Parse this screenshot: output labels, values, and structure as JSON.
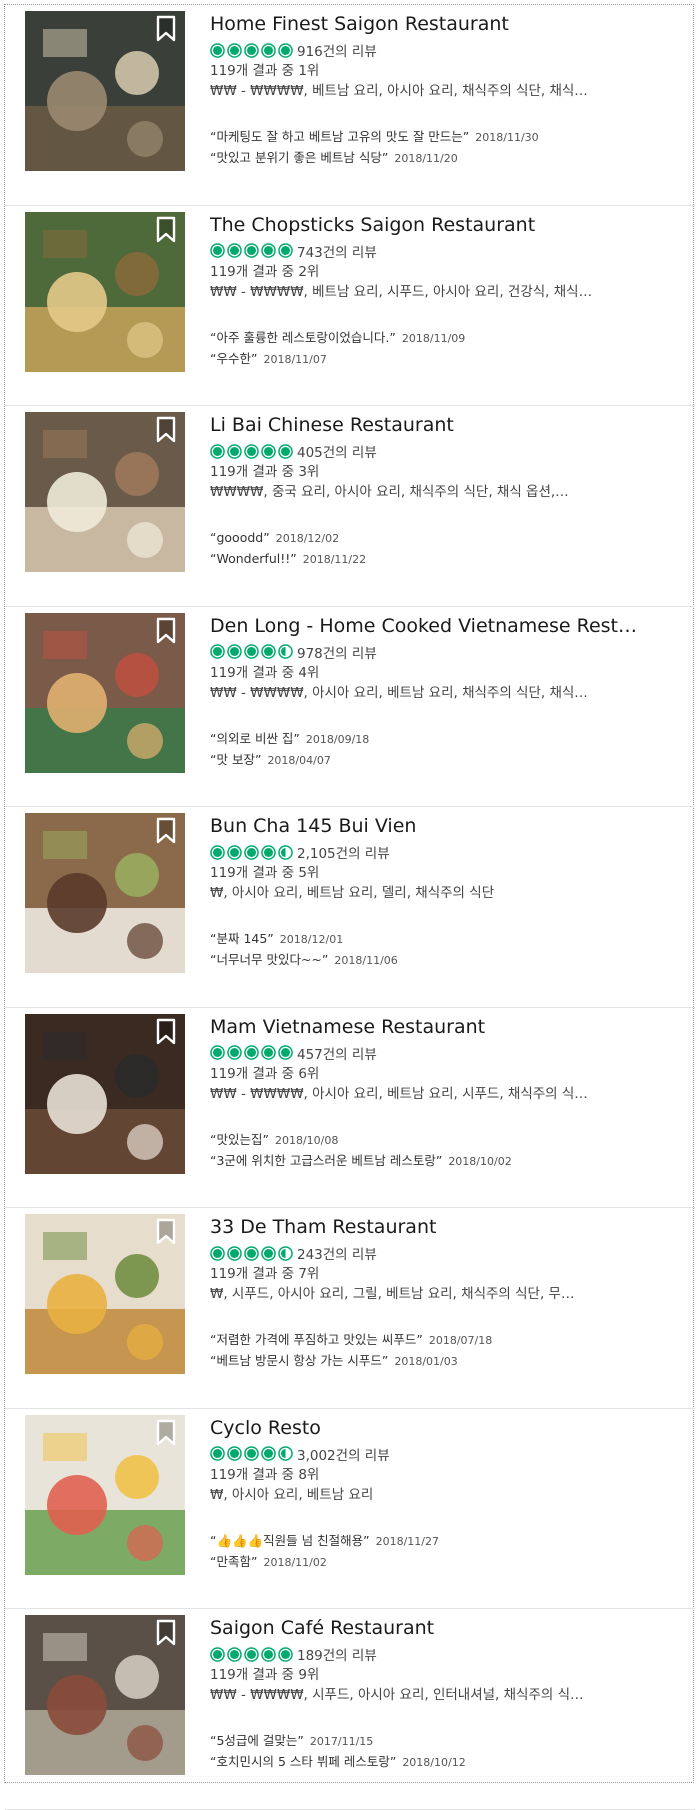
{
  "colors": {
    "bubble": "#00aa6c",
    "divider": "#e3e3e3",
    "bookmark": "#ffffff"
  },
  "restaurants": [
    {
      "name": "Home Finest Saigon Restaurant",
      "rating": 5,
      "reviews": "916건의 리뷰",
      "rank": "119개 결과 중 1위",
      "cuisine": "₩₩ - ₩₩₩₩, 베트남 요리, 아시아 요리, 채식주의 식단, 채식…",
      "snippets": [
        {
          "text": "“마케팅도 잘 하고 베트남 고유의 맛도 잘 만드는”",
          "date": "2018/11/30"
        },
        {
          "text": "“맛있고 분위기 좋은 베트남 식당”",
          "date": "2018/11/20"
        }
      ]
    },
    {
      "name": "The Chopsticks Saigon Restaurant",
      "rating": 5,
      "reviews": "743건의 리뷰",
      "rank": "119개 결과 중 2위",
      "cuisine": "₩₩ - ₩₩₩₩, 베트남 요리, 시푸드, 아시아 요리, 건강식, 채식…",
      "snippets": [
        {
          "text": "“아주 훌륭한 레스토랑이었습니다.”",
          "date": "2018/11/09"
        },
        {
          "text": "“우수한”",
          "date": "2018/11/07"
        }
      ]
    },
    {
      "name": "Li Bai Chinese Restaurant",
      "rating": 5,
      "reviews": "405건의 리뷰",
      "rank": "119개 결과 중 3위",
      "cuisine": "₩₩₩₩, 중국 요리, 아시아 요리, 채식주의 식단, 채식 옵션,…",
      "snippets": [
        {
          "text": "“gooodd”",
          "date": "2018/12/02"
        },
        {
          "text": "“Wonderful!!”",
          "date": "2018/11/22"
        }
      ]
    },
    {
      "name": "Den Long - Home Cooked Vietnamese Resta…",
      "rating": 4.5,
      "reviews": "978건의 리뷰",
      "rank": "119개 결과 중 4위",
      "cuisine": "₩₩ - ₩₩₩₩, 아시아 요리, 베트남 요리, 채식주의 식단, 채식…",
      "snippets": [
        {
          "text": "“의외로 비싼 집”",
          "date": "2018/09/18"
        },
        {
          "text": "“맛 보장”",
          "date": "2018/04/07"
        }
      ]
    },
    {
      "name": "Bun Cha 145 Bui Vien",
      "rating": 4.5,
      "reviews": "2,105건의 리뷰",
      "rank": "119개 결과 중 5위",
      "cuisine": "₩, 아시아 요리, 베트남 요리, 델리, 채식주의 식단",
      "snippets": [
        {
          "text": "“분짜 145”",
          "date": "2018/12/01"
        },
        {
          "text": "“너무너무 맛있다~~”",
          "date": "2018/11/06"
        }
      ]
    },
    {
      "name": "Mam Vietnamese Restaurant",
      "rating": 5,
      "reviews": "457건의 리뷰",
      "rank": "119개 결과 중 6위",
      "cuisine": "₩₩ - ₩₩₩₩, 아시아 요리, 베트남 요리, 시푸드, 채식주의 식…",
      "snippets": [
        {
          "text": "“맛있는집”",
          "date": "2018/10/08"
        },
        {
          "text": "“3군에 위치한 고급스러운 베트남 레스토랑”",
          "date": "2018/10/02"
        }
      ]
    },
    {
      "name": "33 De Tham Restaurant",
      "rating": 4.5,
      "reviews": "243건의 리뷰",
      "rank": "119개 결과 중 7위",
      "cuisine": "₩, 시푸드, 아시아 요리, 그릴, 베트남 요리, 채식주의 식단, 무…",
      "snippets": [
        {
          "text": "“저렴한 가격에 푸짐하고 맛있는 씨푸드”",
          "date": "2018/07/18"
        },
        {
          "text": "“베트남 방문시 항상 가는 시푸드”",
          "date": "2018/01/03"
        }
      ]
    },
    {
      "name": "Cyclo Resto",
      "rating": 4.5,
      "reviews": "3,002건의 리뷰",
      "rank": "119개 결과 중 8위",
      "cuisine": "₩, 아시아 요리, 베트남 요리",
      "snippets": [
        {
          "text": "“👍👍👍직원들 넘 친절해용”",
          "date": "2018/11/27"
        },
        {
          "text": "“만족함”",
          "date": "2018/11/02"
        }
      ]
    },
    {
      "name": "Saigon Café Restaurant",
      "rating": 5,
      "reviews": "189건의 리뷰",
      "rank": "119개 결과 중 9위",
      "cuisine": "₩₩ - ₩₩₩₩, 시푸드, 아시아 요리, 인터내셔널, 채식주의 식…",
      "snippets": [
        {
          "text": "“5성급에 걸맞는”",
          "date": "2017/11/15"
        },
        {
          "text": "“호치민시의 5 스타 뷔페 레스토랑”",
          "date": "2018/10/12"
        }
      ]
    }
  ]
}
